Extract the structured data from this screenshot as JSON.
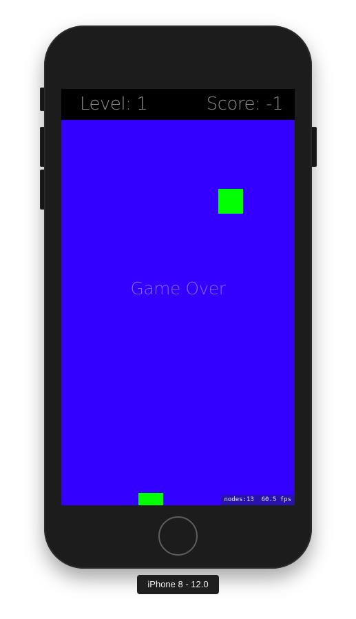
{
  "hud": {
    "level_text": "Level: 1",
    "score_text": "Score: -1"
  },
  "game": {
    "status_text": "Game Over",
    "debug_stats_text": "nodes:13  60.5 fps",
    "colors": {
      "playfield": "#3300ff",
      "blocks": "#00ff00",
      "hud_background": "#000000",
      "hud_text": "#8f8f8f"
    }
  },
  "device": {
    "label": "iPhone 8 - 12.0"
  }
}
